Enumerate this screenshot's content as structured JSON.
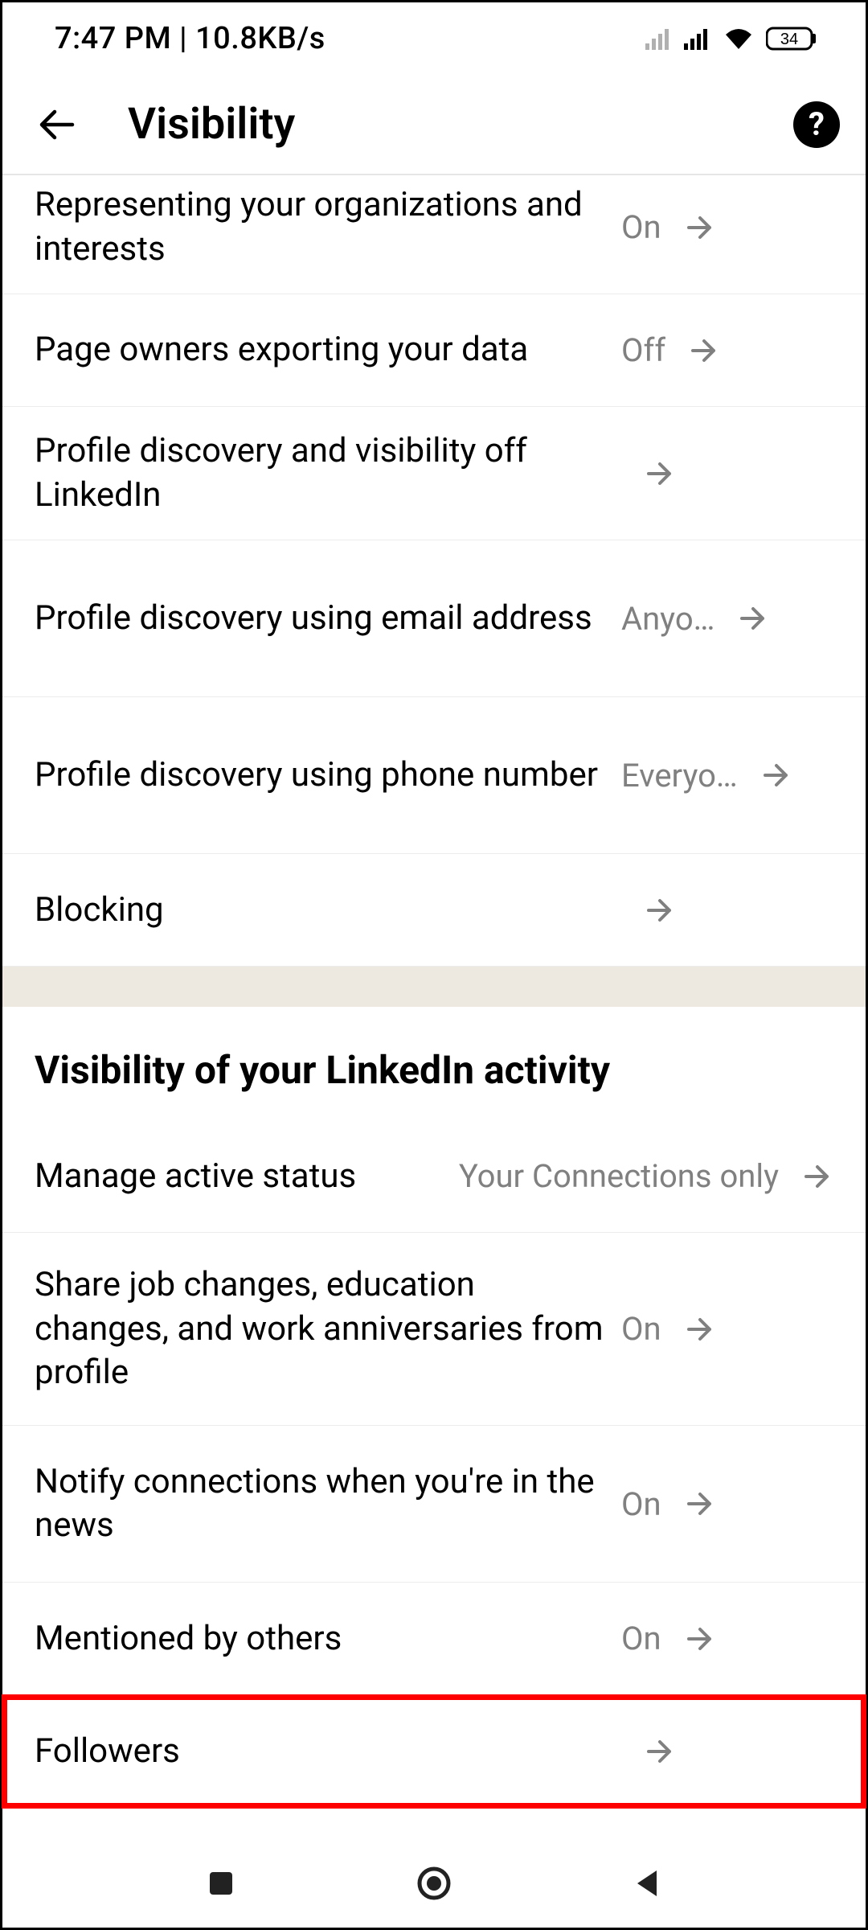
{
  "status": {
    "time": "7:47 PM | 10.8KB/s",
    "battery": "34"
  },
  "header": {
    "title": "Visibility"
  },
  "items": [
    {
      "label": "Representing your organizations and interests",
      "value": "On"
    },
    {
      "label": "Page owners exporting your data",
      "value": "Off"
    },
    {
      "label": "Profile discovery and visibility off LinkedIn",
      "value": ""
    },
    {
      "label": "Profile discovery using email address",
      "value": "Anyo…"
    },
    {
      "label": "Profile discovery using phone number",
      "value": "Everyo…"
    },
    {
      "label": "Blocking",
      "value": ""
    }
  ],
  "section": {
    "title": "Visibility of your LinkedIn activity"
  },
  "items2": [
    {
      "label": "Manage active status",
      "value": "Your Connections only"
    },
    {
      "label": "Share job changes, education changes, and work anniversaries from profile",
      "value": "On"
    },
    {
      "label": "Notify connections when you're in the news",
      "value": "On"
    },
    {
      "label": "Mentioned by others",
      "value": "On"
    },
    {
      "label": "Followers",
      "value": ""
    }
  ]
}
